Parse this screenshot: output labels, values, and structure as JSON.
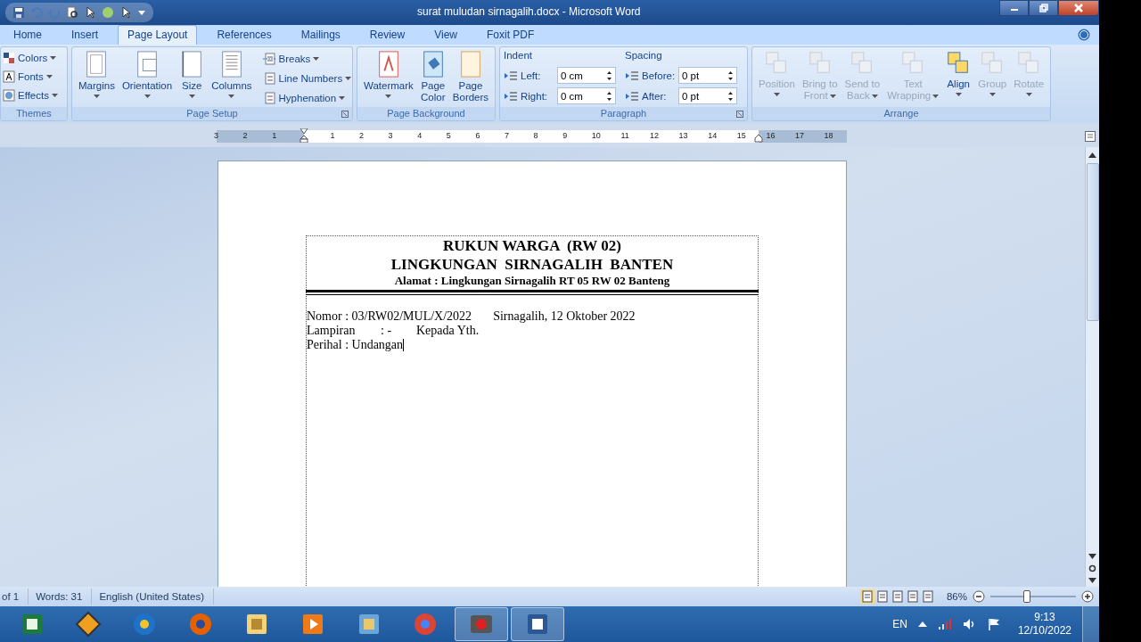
{
  "window": {
    "title": "surat muludan sirnagalih.docx - Microsoft Word"
  },
  "tabs": [
    {
      "label": "Home",
      "selected": false
    },
    {
      "label": "Insert",
      "selected": false
    },
    {
      "label": "Page Layout",
      "selected": true
    },
    {
      "label": "References",
      "selected": false
    },
    {
      "label": "Mailings",
      "selected": false
    },
    {
      "label": "Review",
      "selected": false
    },
    {
      "label": "View",
      "selected": false
    },
    {
      "label": "Foxit PDF",
      "selected": false
    }
  ],
  "ribbon": {
    "themes": {
      "label": "Themes",
      "items": [
        "Colors",
        "Fonts",
        "Effects"
      ]
    },
    "page_setup": {
      "label": "Page Setup",
      "buttons": [
        {
          "kind": "margins",
          "lines": [
            "Margins"
          ]
        },
        {
          "kind": "orientation",
          "lines": [
            "Orientation"
          ]
        },
        {
          "kind": "size",
          "lines": [
            "Size"
          ]
        },
        {
          "kind": "columns",
          "lines": [
            "Columns"
          ]
        }
      ],
      "small": [
        {
          "kind": "breaks",
          "label": "Breaks"
        },
        {
          "kind": "line-numbers",
          "label": "Line Numbers"
        },
        {
          "kind": "hyphenation",
          "label": "Hyphenation"
        }
      ]
    },
    "page_background": {
      "label": "Page Background",
      "buttons": [
        {
          "kind": "watermark",
          "lines": [
            "Watermark"
          ]
        },
        {
          "kind": "page-color",
          "lines": [
            "Page",
            "Color"
          ]
        },
        {
          "kind": "page-borders",
          "lines": [
            "Page",
            "Borders"
          ]
        }
      ]
    },
    "paragraph": {
      "label": "Paragraph",
      "indent": {
        "title": "Indent",
        "fields": [
          {
            "label": "Left:",
            "value": "0 cm"
          },
          {
            "label": "Right:",
            "value": "0 cm"
          }
        ]
      },
      "spacing": {
        "title": "Spacing",
        "fields": [
          {
            "label": "Before:",
            "value": "0 pt"
          },
          {
            "label": "After:",
            "value": "0 pt"
          }
        ]
      }
    },
    "arrange": {
      "label": "Arrange",
      "buttons": [
        {
          "kind": "position",
          "lines": [
            "Position"
          ],
          "disabled": true
        },
        {
          "kind": "bring-front",
          "lines": [
            "Bring to",
            "Front"
          ],
          "disabled": true
        },
        {
          "kind": "send-back",
          "lines": [
            "Send to",
            "Back"
          ],
          "disabled": true
        },
        {
          "kind": "text-wrap",
          "lines": [
            "Text",
            "Wrapping"
          ],
          "disabled": true
        },
        {
          "kind": "align",
          "lines": [
            "Align"
          ],
          "disabled": false
        },
        {
          "kind": "group",
          "lines": [
            "Group"
          ],
          "disabled": true
        },
        {
          "kind": "rotate",
          "lines": [
            "Rotate"
          ],
          "disabled": true
        }
      ]
    }
  },
  "ruler": {
    "labels": [
      "3",
      "2",
      "1",
      "1",
      "2",
      "3",
      "4",
      "5",
      "6",
      "7",
      "8",
      "9",
      "10",
      "11",
      "12",
      "13",
      "14",
      "15",
      "16",
      "17",
      "18"
    ]
  },
  "document": {
    "header": [
      "RUKUN WARGA  (RW 02)",
      "LINGKUNGAN  SIRNAGALIH  BANTEN",
      "Alamat : Lingkungan Sirnagalih RT 05 RW 02 Banteng"
    ],
    "lines": [
      [
        "Nomor : 03/RW02/MUL/X/2022",
        "Sirnagalih, 12 Oktober 2022"
      ],
      [
        "Lampiran",
        ": -",
        "Kepada Yth."
      ],
      [
        "Perihal : Undangan"
      ]
    ]
  },
  "status_bar": {
    "page": "of 1",
    "words": "Words: 31",
    "language": "English (United States)",
    "zoom": "86%",
    "zoom_level": {
      "level": 0.43
    }
  },
  "taskbar": {
    "apps": [
      {
        "kind": "excel",
        "active": false
      },
      {
        "kind": "winamp",
        "active": false
      },
      {
        "kind": "ie",
        "active": false
      },
      {
        "kind": "firefox",
        "active": false
      },
      {
        "kind": "explorer",
        "active": false
      },
      {
        "kind": "media",
        "active": false
      },
      {
        "kind": "photos",
        "active": false
      },
      {
        "kind": "chrome",
        "active": false
      },
      {
        "kind": "recorder",
        "active": true
      },
      {
        "kind": "word",
        "active": true
      }
    ],
    "language": "EN",
    "time": "9:13",
    "date": "12/10/2022"
  }
}
